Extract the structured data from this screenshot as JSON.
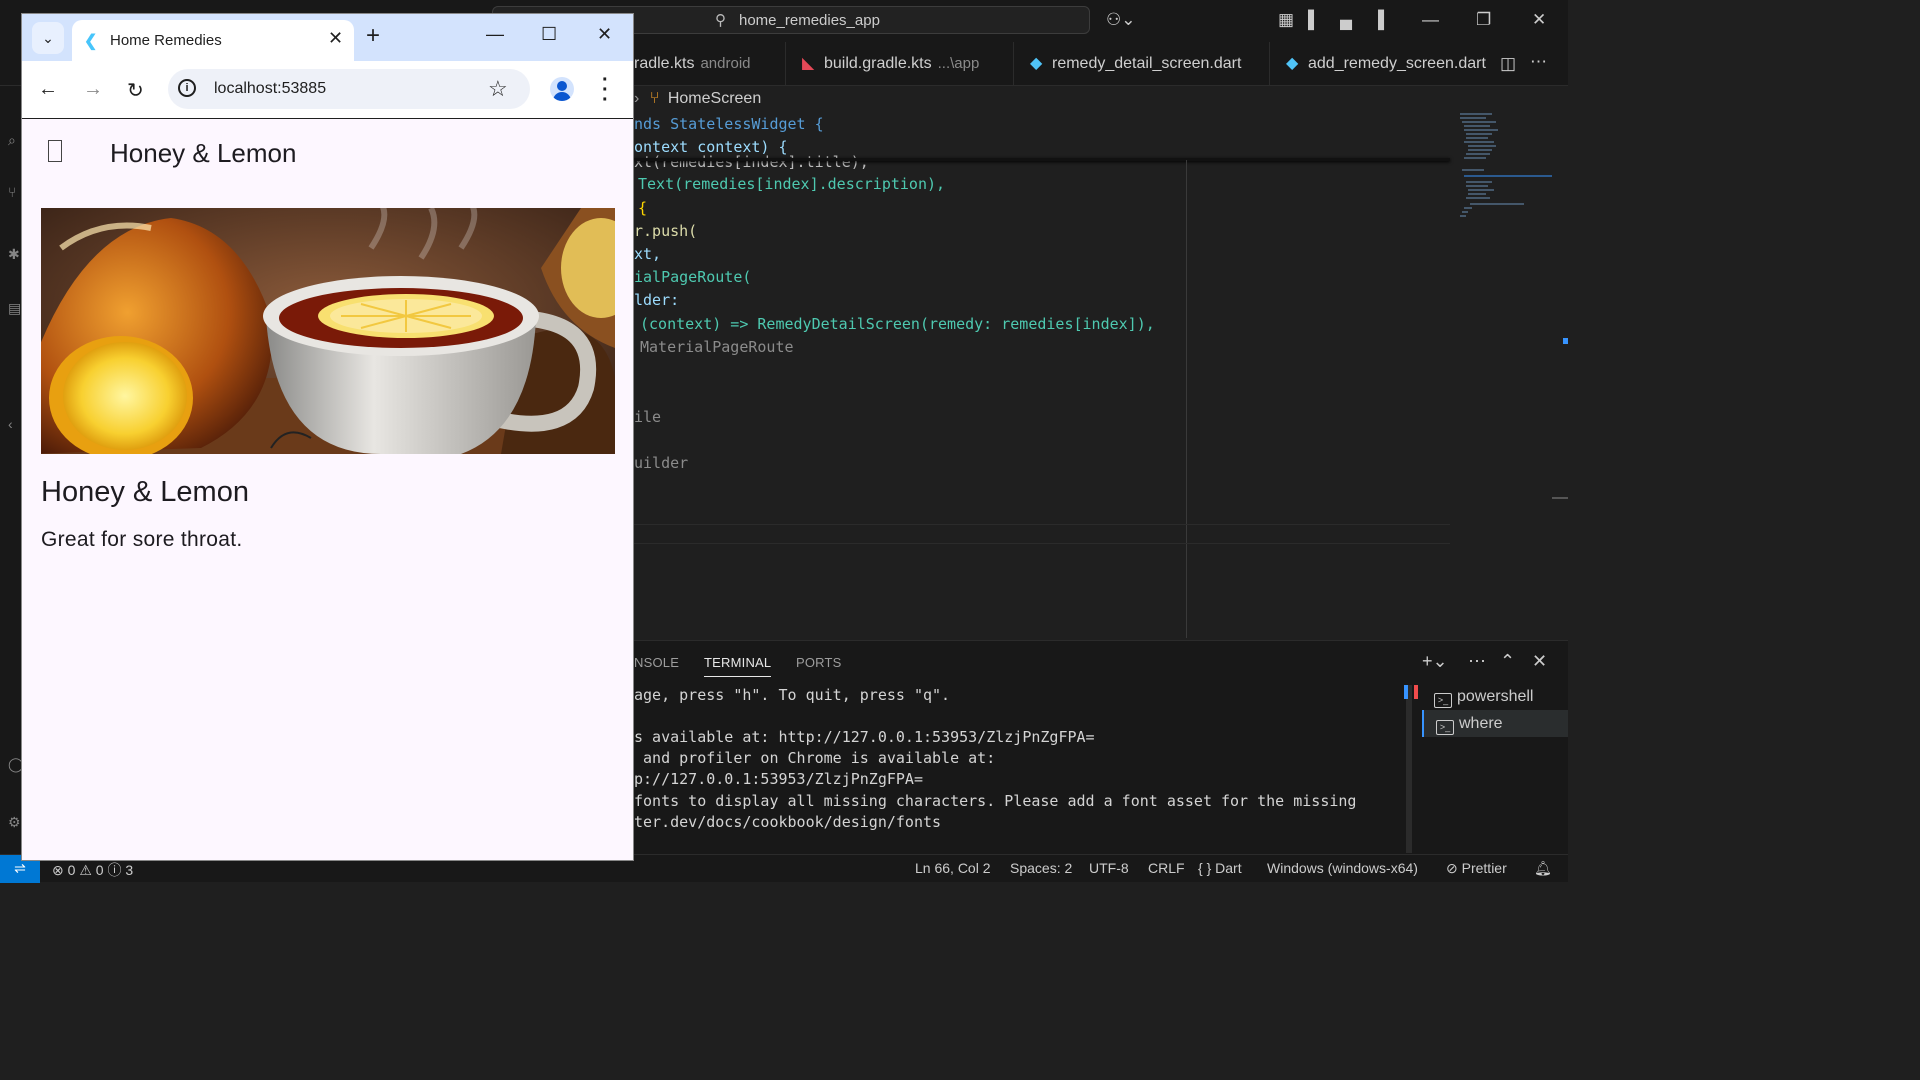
{
  "vscode": {
    "search_text": "home_remedies_app",
    "tabs": [
      {
        "name": "build.gradle.kts",
        "shown": "radle.kts",
        "hint": "android"
      },
      {
        "name": "build.gradle.kts",
        "shown": "build.gradle.kts",
        "hint": "...\\app"
      },
      {
        "name": "remedy_detail_screen.dart",
        "shown": "remedy_detail_screen.dart",
        "hint": ""
      },
      {
        "name": "add_remedy_screen.dart",
        "shown": "add_remedy_screen.dart",
        "hint": ""
      }
    ],
    "breadcrumb": "HomeScreen",
    "code": {
      "l1": "nds StatelessWidget {",
      "l2": "ontext context) {",
      "l3": "xt(remedies[index].title),",
      "l4": "Text(remedies[index].description),",
      "l5": "{",
      "l6": "r.push(",
      "l7": "xt,",
      "l8": "ialPageRoute(",
      "l9": "lder:",
      "l10": "(context) => RemedyDetailScreen(remedy: remedies[index]),",
      "l11": "MaterialPageRoute",
      "l12": "ile",
      "l13": "uilder"
    },
    "panel_tabs": {
      "console": "NSOLE",
      "terminal": "TERMINAL",
      "ports": "PORTS"
    },
    "terminal_lines": [
      "age, press \"h\". To quit, press \"q\".",
      "",
      "s available at: http://127.0.0.1:53953/ZlzjPnZgFPA=",
      " and profiler on Chrome is available at:",
      "p://127.0.0.1:53953/ZlzjPnZgFPA=",
      "fonts to display all missing characters. Please add a font asset for the missing",
      "ter.dev/docs/cookbook/design/fonts"
    ],
    "terminals": [
      "powershell",
      "where"
    ],
    "status": {
      "problems_errors": "0",
      "problems_warnings": "0",
      "problems_info": "3",
      "position": "Ln 66, Col 2",
      "spaces": "Spaces: 2",
      "encoding": "UTF-8",
      "eol": "CRLF",
      "language": "Dart",
      "platform": "Windows (windows-x64)",
      "formatter": "Prettier"
    }
  },
  "chrome": {
    "tab_title": "Home Remedies",
    "url": "localhost:53885"
  },
  "app": {
    "appbar_title": "Honey & Lemon",
    "detail_title": "Honey & Lemon",
    "detail_description": "Great for sore throat."
  },
  "colors": {
    "vscode_bg": "#1f1f1f",
    "chrome_tabstrip": "#d3e3fd",
    "app_bg": "#fdf7ff",
    "statusbar_remote": "#0078d4"
  }
}
